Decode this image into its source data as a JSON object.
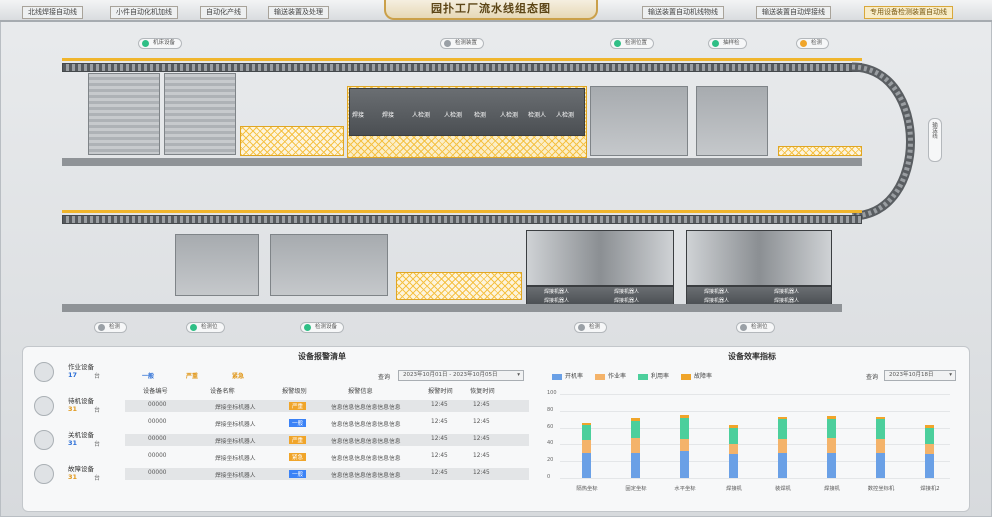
{
  "nav": {
    "left_tabs": [
      "北线焊接自动线",
      "小件自动化机加线",
      "自动化产线",
      "输送装置及处理"
    ],
    "title": "园扑工厂流水线组态图",
    "right_tabs": [
      "输送装置自动机线物线",
      "输送装置自动焊接线",
      "专用设备检测装置自动线"
    ]
  },
  "line": {
    "top_pills": [
      "机床设备",
      "检测装置",
      "检测位置",
      "抽样检",
      "检测"
    ],
    "side_pill": "输送线",
    "stations": [
      "焊接",
      "焊接",
      "人检测",
      "人检测",
      "检测",
      "人检测",
      "检测人",
      "人检测"
    ],
    "bottom_pills": [
      "检测",
      "检测位",
      "检测设备",
      "检测",
      "检测位"
    ],
    "robot_cells": [
      {
        "labels": [
          "焊接机器人",
          "焊接机器人",
          "焊接机器人",
          "焊接机器人"
        ]
      },
      {
        "labels": [
          "焊接机器人",
          "焊接机器人",
          "焊接机器人",
          "焊接机器人"
        ]
      }
    ]
  },
  "alarm": {
    "section_title": "设备报警清单",
    "level_tabs": [
      "一般",
      "严重",
      "紧急"
    ],
    "query_label": "查询",
    "date_range": "2023年10月01日 - 2023年10月05日",
    "columns": [
      "设备编号",
      "设备名称",
      "报警级别",
      "报警信息",
      "报警时间",
      "恢复时间"
    ],
    "rows": [
      {
        "id": "00000",
        "name": "焊接坐标机器人",
        "level": "严重",
        "msg": "信息信息信息信息信息信息",
        "time": "12:45",
        "recover": "12:45"
      },
      {
        "id": "00000",
        "name": "焊接坐标机器人",
        "level": "一般",
        "msg": "信息信息信息信息信息信息",
        "time": "12:45",
        "recover": "12:45"
      },
      {
        "id": "00000",
        "name": "焊接坐标机器人",
        "level": "严重",
        "msg": "信息信息信息信息信息信息",
        "time": "12:45",
        "recover": "12:45"
      },
      {
        "id": "00000",
        "name": "焊接坐标机器人",
        "level": "紧急",
        "msg": "信息信息信息信息信息信息",
        "time": "12:45",
        "recover": "12:45"
      },
      {
        "id": "00000",
        "name": "焊接坐标机器人",
        "level": "一般",
        "msg": "信息信息信息信息信息信息",
        "time": "12:45",
        "recover": "12:45"
      }
    ],
    "level_colors": {
      "一般": "#3b82f6",
      "严重": "#f0a52a",
      "紧急": "#f0a52a"
    }
  },
  "devices": [
    {
      "name": "作业设备",
      "count": "17",
      "unit": "台",
      "color": "#2b6ed6"
    },
    {
      "name": "待机设备",
      "count": "31",
      "unit": "台",
      "color": "#e0981c"
    },
    {
      "name": "关机设备",
      "count": "31",
      "unit": "台",
      "color": "#2b6ed6"
    },
    {
      "name": "故障设备",
      "count": "31",
      "unit": "台",
      "color": "#e0981c"
    }
  ],
  "efficiency": {
    "section_title": "设备效率指标",
    "query_label": "查询",
    "date": "2023年10月18日",
    "legend": [
      {
        "name": "开机率",
        "color": "#6aa0e6"
      },
      {
        "name": "作业率",
        "color": "#f4b36a"
      },
      {
        "name": "利用率",
        "color": "#4ccf9c"
      },
      {
        "name": "故障率",
        "color": "#f0a52a"
      }
    ]
  },
  "chart_data": {
    "type": "bar",
    "stacked": true,
    "ylim": [
      0,
      100
    ],
    "yticks": [
      0,
      20,
      40,
      60,
      80,
      100
    ],
    "categories": [
      "隔热坐标",
      "固定坐标",
      "水平坐标",
      "焊接机",
      "装焊机",
      "焊接机",
      "数控坐标机",
      "焊接机2"
    ],
    "series": [
      {
        "name": "开机率",
        "values": [
          30,
          30,
          32,
          28,
          30,
          30,
          30,
          28
        ]
      },
      {
        "name": "作业率",
        "values": [
          15,
          18,
          15,
          12,
          16,
          18,
          16,
          12
        ]
      },
      {
        "name": "利用率",
        "values": [
          18,
          20,
          24,
          20,
          24,
          22,
          24,
          20
        ]
      },
      {
        "name": "故障率",
        "values": [
          3,
          3,
          4,
          3,
          3,
          4,
          3,
          3
        ]
      }
    ]
  }
}
